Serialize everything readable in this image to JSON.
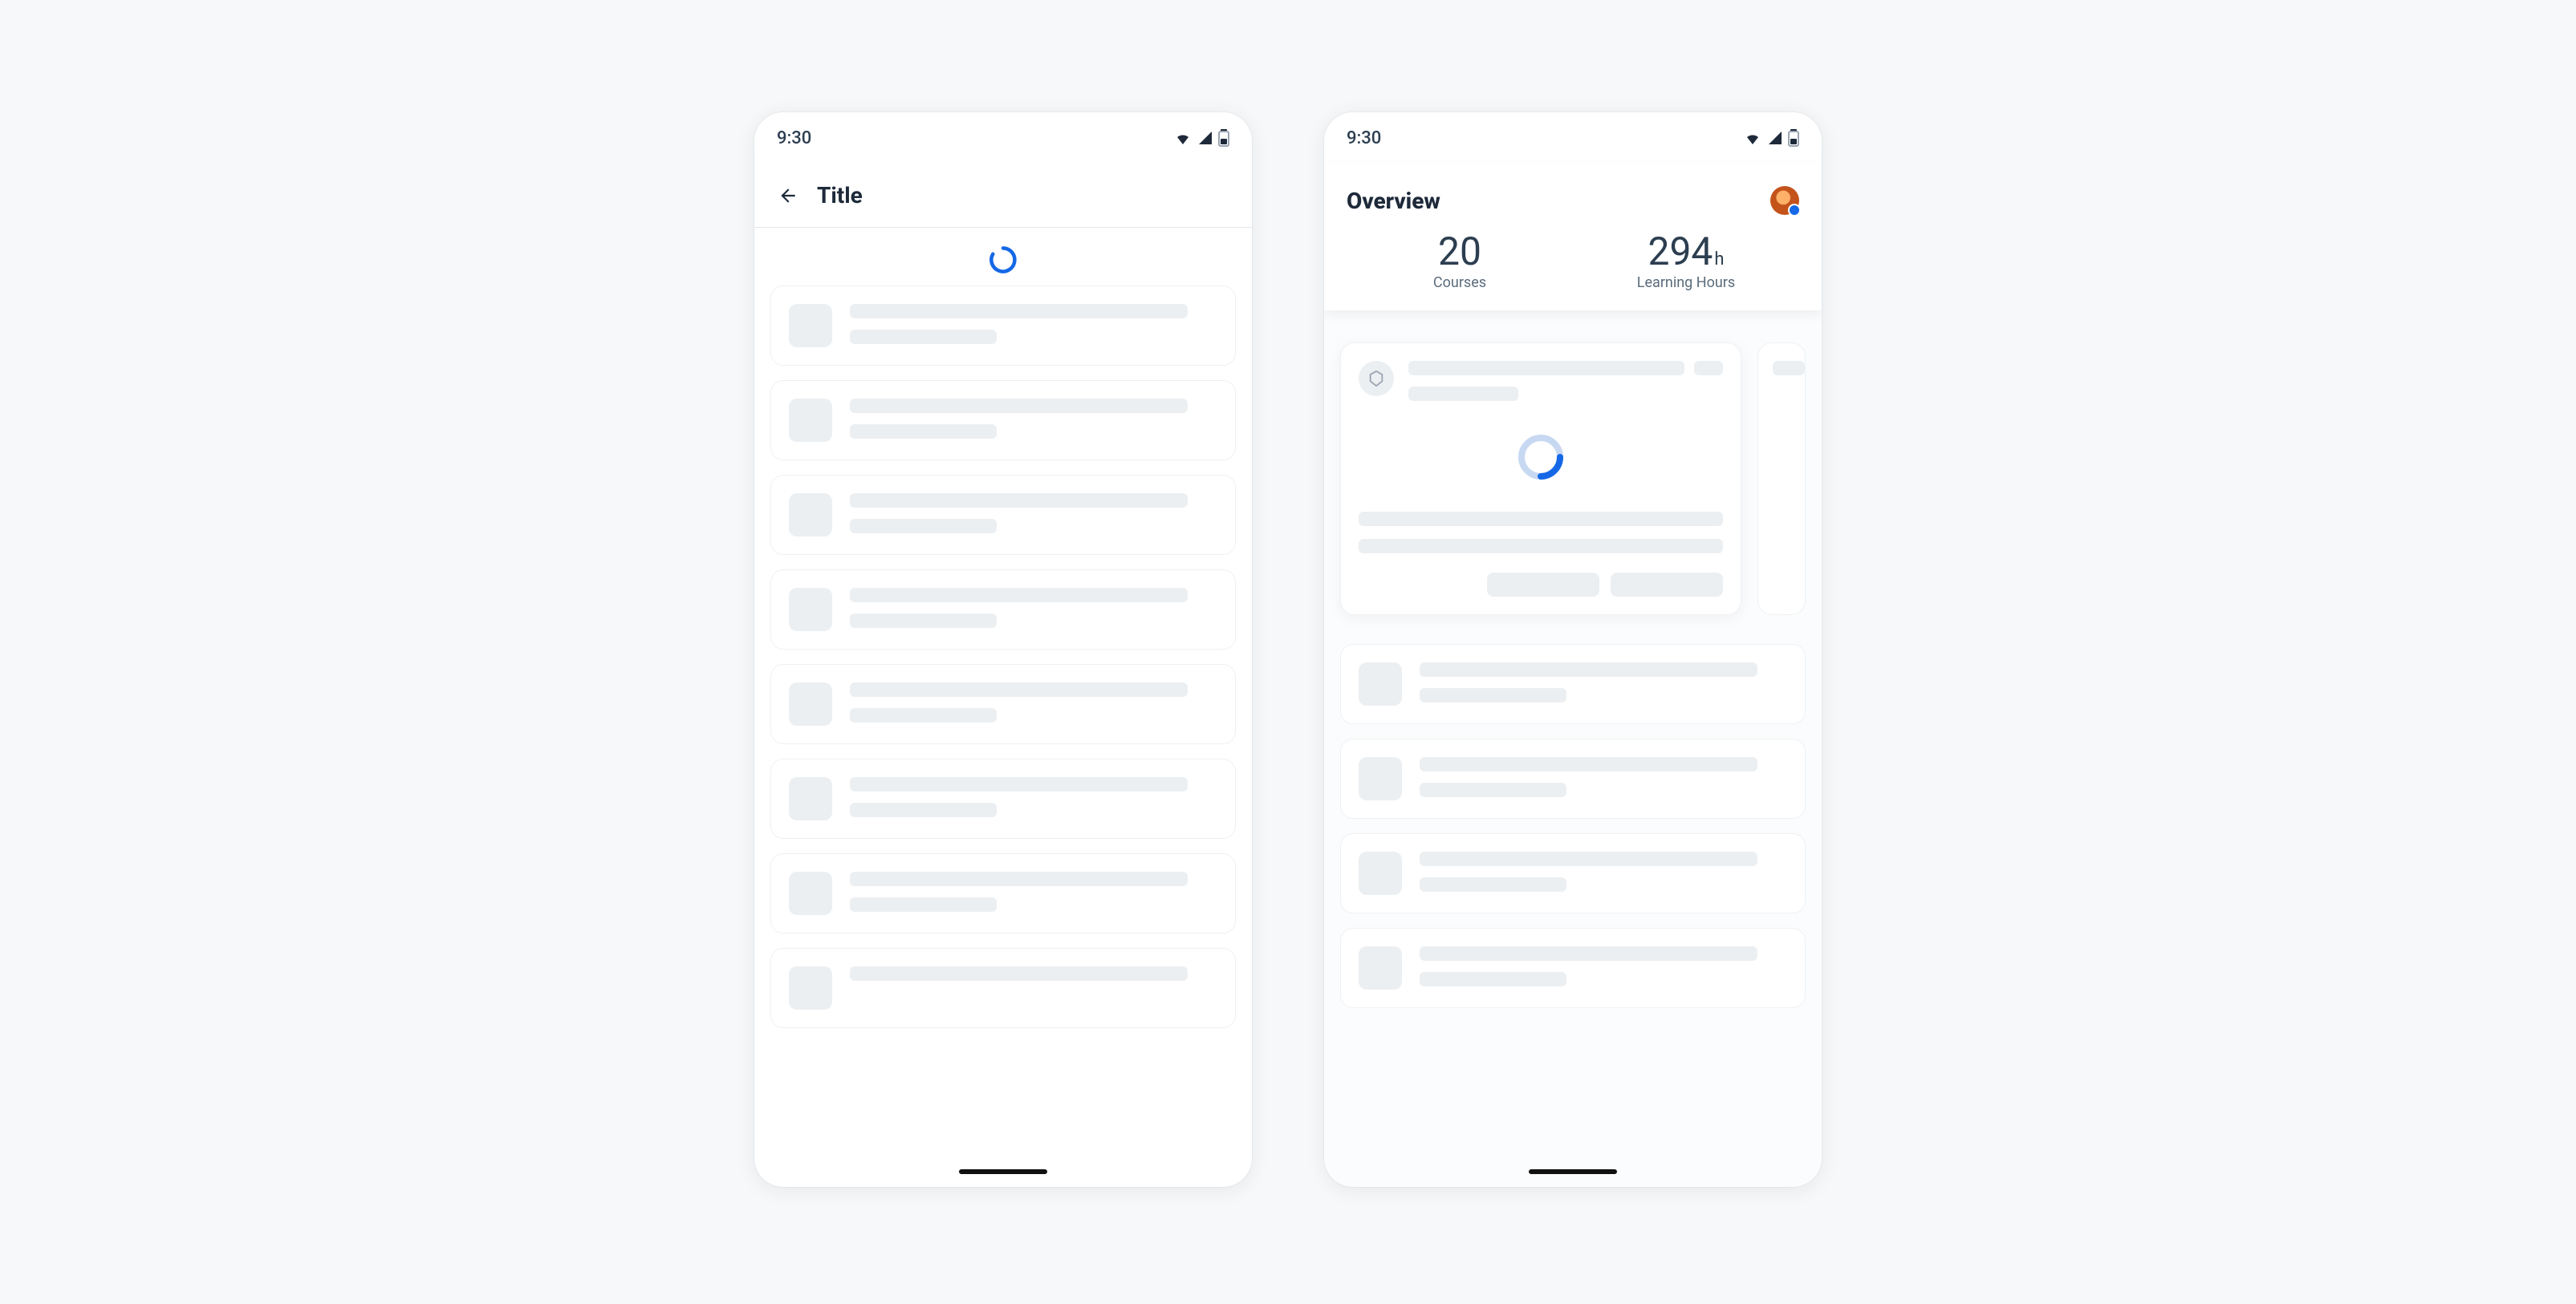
{
  "statusbar": {
    "time": "9:30"
  },
  "phone1": {
    "appbar": {
      "title": "Title"
    }
  },
  "phone2": {
    "header": {
      "title": "Overview",
      "stats": {
        "courses": {
          "value": "20",
          "label": "Courses"
        },
        "hours": {
          "value": "294",
          "unit": "h",
          "label": "Learning Hours"
        }
      }
    }
  }
}
